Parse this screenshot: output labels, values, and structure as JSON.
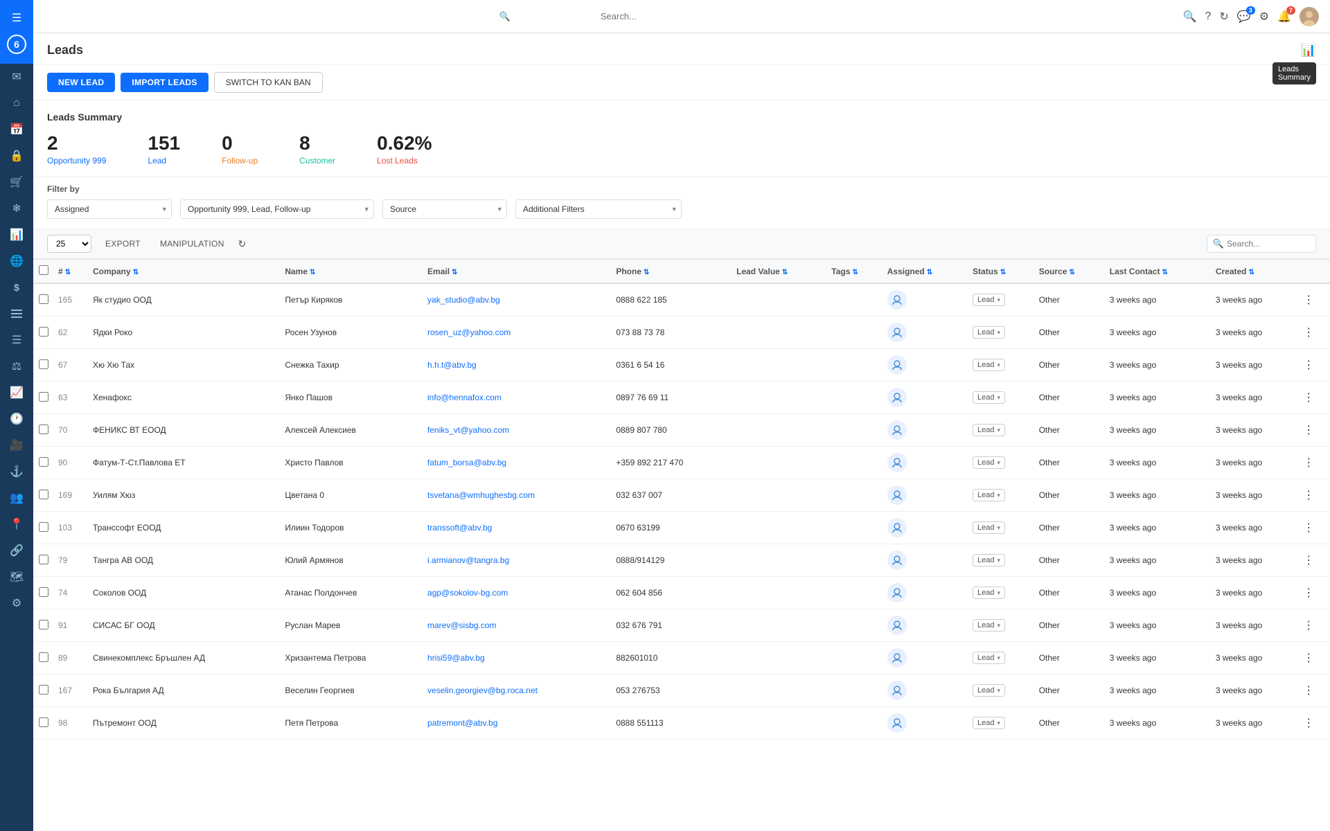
{
  "sidebar": {
    "brand": "6",
    "icons": [
      {
        "name": "menu-icon",
        "symbol": "☰"
      },
      {
        "name": "envelope-icon",
        "symbol": "✉"
      },
      {
        "name": "home-icon",
        "symbol": "⌂"
      },
      {
        "name": "calendar-icon",
        "symbol": "📅"
      },
      {
        "name": "lock-icon",
        "symbol": "🔒"
      },
      {
        "name": "cart-icon",
        "symbol": "🛒"
      },
      {
        "name": "snowflake-icon",
        "symbol": "❄"
      },
      {
        "name": "chart-bar-icon",
        "symbol": "📊"
      },
      {
        "name": "globe-icon",
        "symbol": "🌐"
      },
      {
        "name": "dollar-icon",
        "symbol": "$"
      },
      {
        "name": "list-icon",
        "symbol": "☰"
      },
      {
        "name": "filter-icon",
        "symbol": "⚙"
      },
      {
        "name": "balance-icon",
        "symbol": "⚖"
      },
      {
        "name": "graph-icon",
        "symbol": "📈"
      },
      {
        "name": "clock-icon",
        "symbol": "🕐"
      },
      {
        "name": "video-icon",
        "symbol": "🎥"
      },
      {
        "name": "anchor-icon",
        "symbol": "⚓"
      },
      {
        "name": "users-icon",
        "symbol": "👥"
      },
      {
        "name": "location-icon",
        "symbol": "📍"
      },
      {
        "name": "network-icon",
        "symbol": "🔗"
      },
      {
        "name": "map-icon",
        "symbol": "🗺"
      },
      {
        "name": "settings-icon",
        "symbol": "⚙"
      }
    ]
  },
  "navbar": {
    "search_placeholder": "Search...",
    "notification_count": "3",
    "alert_count": "7"
  },
  "page": {
    "title": "Leads",
    "tooltip": "Leads\nSummary"
  },
  "actions": {
    "new_lead": "NEW LEAD",
    "import_leads": "IMPORT LEADS",
    "switch_kanban": "SWITCH TO KAN BAN"
  },
  "summary": {
    "title": "Leads Summary",
    "cards": [
      {
        "number": "2",
        "label": "Opportunity 999",
        "color": "blue"
      },
      {
        "number": "151",
        "label": "Lead",
        "color": "blue"
      },
      {
        "number": "0",
        "label": "Follow-up",
        "color": "orange"
      },
      {
        "number": "8",
        "label": "Customer",
        "color": "teal"
      },
      {
        "number": "0.62%",
        "label": "Lost Leads",
        "color": "red"
      }
    ]
  },
  "filters": {
    "label": "Filter by",
    "assigned": "Assigned",
    "status": "Opportunity 999, Lead, Follow-up",
    "source": "Source",
    "additional": "Additional Filters"
  },
  "table_toolbar": {
    "page_size": "25",
    "export": "EXPORT",
    "manipulation": "MANIPULATION",
    "search_placeholder": "Search..."
  },
  "table": {
    "columns": [
      "#",
      "Company",
      "Name",
      "Email",
      "Phone",
      "Lead Value",
      "Tags",
      "Assigned",
      "Status",
      "Source",
      "Last Contact",
      "Created"
    ],
    "rows": [
      {
        "id": 165,
        "company": "Як студио ООД",
        "name": "Петър Киряков",
        "email": "yak_studio@abv.bg",
        "phone": "0888 622 185",
        "lead_value": "",
        "tags": "",
        "assigned": "",
        "status": "Lead",
        "source": "Other",
        "last_contact": "3 weeks ago",
        "created": "3 weeks ago"
      },
      {
        "id": 62,
        "company": "Ядки Роко",
        "name": "Росен Узунов",
        "email": "rosen_uz@yahoo.com",
        "phone": "073 88 73 78",
        "lead_value": "",
        "tags": "",
        "assigned": "",
        "status": "Lead",
        "source": "Other",
        "last_contact": "3 weeks ago",
        "created": "3 weeks ago"
      },
      {
        "id": 67,
        "company": "Хю Хю Тах",
        "name": "Снежка Тахир",
        "email": "h.h.t@abv.bg",
        "phone": "0361 6 54 16",
        "lead_value": "",
        "tags": "",
        "assigned": "",
        "status": "Lead",
        "source": "Other",
        "last_contact": "3 weeks ago",
        "created": "3 weeks ago"
      },
      {
        "id": 63,
        "company": "Хенафокс",
        "name": "Янко Пашов",
        "email": "info@hennafox.com",
        "phone": "0897 76 69 11",
        "lead_value": "",
        "tags": "",
        "assigned": "",
        "status": "Lead",
        "source": "Other",
        "last_contact": "3 weeks ago",
        "created": "3 weeks ago"
      },
      {
        "id": 70,
        "company": "ФЕНИКС ВТ ЕООД",
        "name": "Алексей Алексиев",
        "email": "feniks_vt@yahoo.com",
        "phone": "0889 807 780",
        "lead_value": "",
        "tags": "",
        "assigned": "",
        "status": "Lead",
        "source": "Other",
        "last_contact": "3 weeks ago",
        "created": "3 weeks ago"
      },
      {
        "id": 90,
        "company": "Фатум-Т-Ст.Павлова ЕТ",
        "name": "Христо Павлов",
        "email": "fatum_borsa@abv.bg",
        "phone": "+359 892 217 470",
        "lead_value": "",
        "tags": "",
        "assigned": "",
        "status": "Lead",
        "source": "Other",
        "last_contact": "3 weeks ago",
        "created": "3 weeks ago"
      },
      {
        "id": 169,
        "company": "Уилям Хюз",
        "name": "Цветана 0",
        "email": "tsvetana@wmhughesbg.com",
        "phone": "032 637 007",
        "lead_value": "",
        "tags": "",
        "assigned": "",
        "status": "Lead",
        "source": "Other",
        "last_contact": "3 weeks ago",
        "created": "3 weeks ago"
      },
      {
        "id": 103,
        "company": "Транссофт ЕООД",
        "name": "Илиин Тодоров",
        "email": "transsoft@abv.bg",
        "phone": "0670 63199",
        "lead_value": "",
        "tags": "",
        "assigned": "",
        "status": "Lead",
        "source": "Other",
        "last_contact": "3 weeks ago",
        "created": "3 weeks ago"
      },
      {
        "id": 79,
        "company": "Тангра АВ ООД",
        "name": "Юлий Армянов",
        "email": "i.armianov@tangra.bg",
        "phone": "0888/914129",
        "lead_value": "",
        "tags": "",
        "assigned": "",
        "status": "Lead",
        "source": "Other",
        "last_contact": "3 weeks ago",
        "created": "3 weeks ago"
      },
      {
        "id": 74,
        "company": "Соколов ООД",
        "name": "Атанас Полдончев",
        "email": "agp@sokolov-bg.com",
        "phone": "062 604 856",
        "lead_value": "",
        "tags": "",
        "assigned": "",
        "status": "Lead",
        "source": "Other",
        "last_contact": "3 weeks ago",
        "created": "3 weeks ago"
      },
      {
        "id": 91,
        "company": "СИСАС БГ ООД",
        "name": "Руслан Марев",
        "email": "marev@sisbg.com",
        "phone": "032 676 791",
        "lead_value": "",
        "tags": "",
        "assigned": "",
        "status": "Lead",
        "source": "Other",
        "last_contact": "3 weeks ago",
        "created": "3 weeks ago"
      },
      {
        "id": 89,
        "company": "Свинекомплекс Бръшлен АД",
        "name": "Хризантема Петрова",
        "email": "hrisi59@abv.bg",
        "phone": "882601010",
        "lead_value": "",
        "tags": "",
        "assigned": "",
        "status": "Lead",
        "source": "Other",
        "last_contact": "3 weeks ago",
        "created": "3 weeks ago"
      },
      {
        "id": 167,
        "company": "Рока България АД",
        "name": "Веселин Георгиев",
        "email": "veselin.georgiev@bg.roca.net",
        "phone": "053 276753",
        "lead_value": "",
        "tags": "",
        "assigned": "",
        "status": "Lead",
        "source": "Other",
        "last_contact": "3 weeks ago",
        "created": "3 weeks ago"
      },
      {
        "id": 98,
        "company": "Пътремонт ООД",
        "name": "Петя Петрова",
        "email": "patremont@abv.bg",
        "phone": "0888 551113",
        "lead_value": "",
        "tags": "",
        "assigned": "",
        "status": "Lead",
        "source": "Other",
        "last_contact": "3 weeks ago",
        "created": "3 weeks ago"
      }
    ]
  }
}
